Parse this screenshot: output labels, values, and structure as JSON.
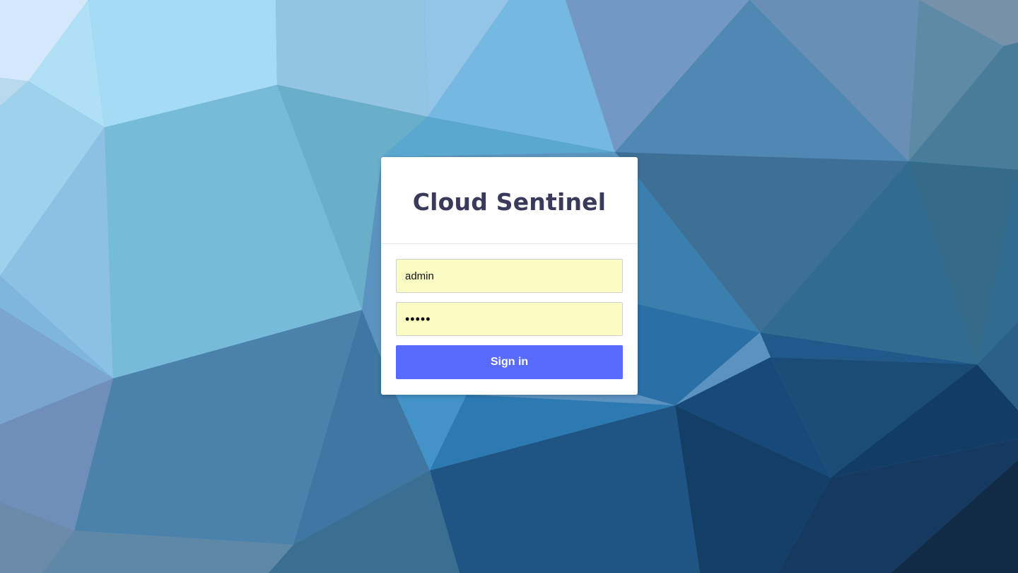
{
  "app": {
    "title": "Cloud Sentinel"
  },
  "login_form": {
    "username": {
      "value": "admin"
    },
    "password": {
      "value": "•••••"
    },
    "submit_label": "Sign in"
  },
  "colors": {
    "title_text": "#3a3a5c",
    "input_autofill_background": "#fafcc4",
    "button_background": "#596bfd",
    "button_text": "#ffffff",
    "card_background": "#ffffff"
  }
}
